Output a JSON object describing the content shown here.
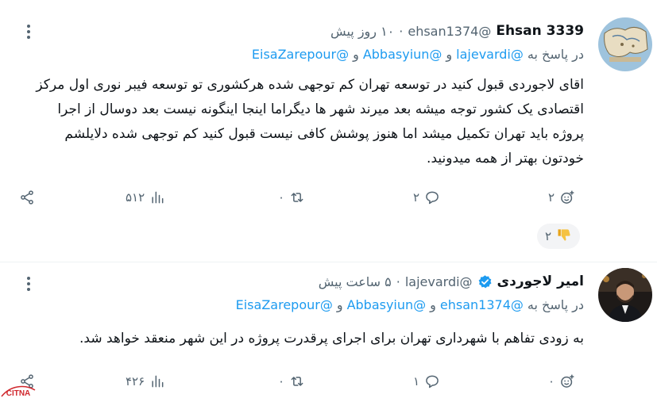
{
  "colors": {
    "link": "#1d9bf0",
    "secondary": "#536471",
    "text": "#0f1419"
  },
  "tweets": [
    {
      "name": "Ehsan 3339",
      "handle": "@ehsan1374",
      "separator": "·",
      "time": "۱۰ روز پیش",
      "reply_prefix": "در پاسخ به",
      "reply_mentions": [
        "@lajevardi",
        "@Abbasyiun",
        "@EisaZarepour"
      ],
      "reply_joiner": "و",
      "text": "اقای لاجوردی قبول کنید در توسعه تهران  کم توجهی شده هرکشوری تو توسعه فیبر نوری اول مرکز اقتصادی  یک کشور توجه میشه بعد میرند شهر ها دیگراما اینجا اینگونه نیست  بعد دوسال از اجرا پروژه باید تهران تکمیل میشد اما هنوز  پوشش کافی نیست قبول کنید کم توجهی شده دلایلشم خودتون بهتر از همه میدونید.",
      "actions": {
        "like": "۲",
        "reply": "۲",
        "retweet": "۰",
        "views": "۵۱۲"
      },
      "reaction": {
        "icon": "thumbs-down-emoji",
        "count": "۲"
      }
    },
    {
      "name": "امیر لاجوردی",
      "verified": true,
      "handle": "@lajevardi",
      "separator": "·",
      "time": "۵ ساعت پیش",
      "reply_prefix": "در پاسخ به",
      "reply_mentions": [
        "@ehsan1374",
        "@Abbasyiun",
        "@EisaZarepour"
      ],
      "reply_joiner": "و",
      "text": "به زودی تفاهم با شهرداری تهران برای اجرای پرقدرت پروژه در این شهر منعقد خواهد شد.",
      "actions": {
        "like": "۰",
        "reply": "۱",
        "retweet": "۰",
        "views": "۴۲۶"
      }
    }
  ],
  "watermark": "CITNA"
}
